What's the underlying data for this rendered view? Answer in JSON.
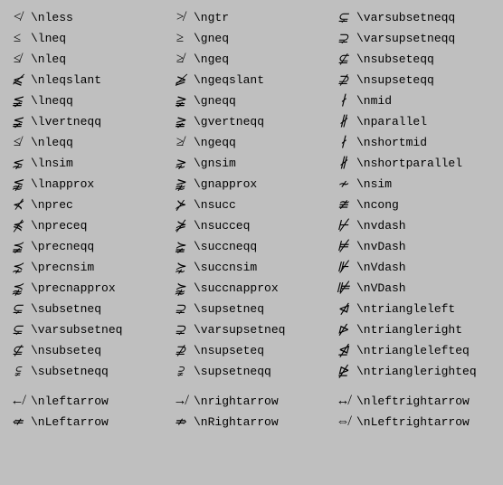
{
  "rows": [
    [
      {
        "sym": "≮",
        "cmd": "\\nless"
      },
      {
        "sym": "≯",
        "cmd": "\\ngtr"
      },
      {
        "sym": "⊊",
        "cmd": "\\varsubsetneqq"
      }
    ],
    [
      {
        "sym": "≤",
        "cmd": "\\lneq"
      },
      {
        "sym": "≥",
        "cmd": "\\gneq"
      },
      {
        "sym": "⊋",
        "cmd": "\\varsupsetneqq"
      }
    ],
    [
      {
        "sym": "≰",
        "cmd": "\\nleq"
      },
      {
        "sym": "≱",
        "cmd": "\\ngeq"
      },
      {
        "sym": "⊈",
        "cmd": "\\nsubseteqq"
      }
    ],
    [
      {
        "sym": "⩽̸",
        "cmd": "\\nleqslant"
      },
      {
        "sym": "⩾̸",
        "cmd": "\\ngeqslant"
      },
      {
        "sym": "⊉",
        "cmd": "\\nsupseteqq"
      }
    ],
    [
      {
        "sym": "≨",
        "cmd": "\\lneqq"
      },
      {
        "sym": "≩",
        "cmd": "\\gneqq"
      },
      {
        "sym": "∤",
        "cmd": "\\nmid"
      }
    ],
    [
      {
        "sym": "≨",
        "cmd": "\\lvertneqq"
      },
      {
        "sym": "≩",
        "cmd": "\\gvertneqq"
      },
      {
        "sym": "∦",
        "cmd": "\\nparallel"
      }
    ],
    [
      {
        "sym": "≰",
        "cmd": "\\nleqq"
      },
      {
        "sym": "≱",
        "cmd": "\\ngeqq"
      },
      {
        "sym": "∤",
        "cmd": "\\nshortmid"
      }
    ],
    [
      {
        "sym": "⋦",
        "cmd": "\\lnsim"
      },
      {
        "sym": "⋧",
        "cmd": "\\gnsim"
      },
      {
        "sym": "∦",
        "cmd": "\\nshortparallel"
      }
    ],
    [
      {
        "sym": "⪉",
        "cmd": "\\lnapprox"
      },
      {
        "sym": "⪊",
        "cmd": "\\gnapprox"
      },
      {
        "sym": "≁",
        "cmd": "\\nsim"
      }
    ],
    [
      {
        "sym": "⊀",
        "cmd": "\\nprec"
      },
      {
        "sym": "⊁",
        "cmd": "\\nsucc"
      },
      {
        "sym": "≇",
        "cmd": "\\ncong"
      }
    ],
    [
      {
        "sym": "⋠",
        "cmd": "\\npreceq"
      },
      {
        "sym": "⋡",
        "cmd": "\\nsucceq"
      },
      {
        "sym": "⊬",
        "cmd": "\\nvdash"
      }
    ],
    [
      {
        "sym": "⪵",
        "cmd": "\\precneqq"
      },
      {
        "sym": "⪶",
        "cmd": "\\succneqq"
      },
      {
        "sym": "⊭",
        "cmd": "\\nvDash"
      }
    ],
    [
      {
        "sym": "⋨",
        "cmd": "\\precnsim"
      },
      {
        "sym": "⋩",
        "cmd": "\\succnsim"
      },
      {
        "sym": "⊮",
        "cmd": "\\nVdash"
      }
    ],
    [
      {
        "sym": "⪹",
        "cmd": "\\precnapprox"
      },
      {
        "sym": "⪺",
        "cmd": "\\succnapprox"
      },
      {
        "sym": "⊯",
        "cmd": "\\nVDash"
      }
    ],
    [
      {
        "sym": "⊊",
        "cmd": "\\subsetneq"
      },
      {
        "sym": "⊋",
        "cmd": "\\supsetneq"
      },
      {
        "sym": "⋪",
        "cmd": "\\ntriangleleft"
      }
    ],
    [
      {
        "sym": "⊊",
        "cmd": "\\varsubsetneq"
      },
      {
        "sym": "⊋",
        "cmd": "\\varsupsetneq"
      },
      {
        "sym": "⋫",
        "cmd": "\\ntriangleright"
      }
    ],
    [
      {
        "sym": "⊈",
        "cmd": "\\nsubseteq"
      },
      {
        "sym": "⊉",
        "cmd": "\\nsupseteq"
      },
      {
        "sym": "⋬",
        "cmd": "\\ntrianglelefteq"
      }
    ],
    [
      {
        "sym": "⫋",
        "cmd": "\\subsetneqq"
      },
      {
        "sym": "⫌",
        "cmd": "\\supsetneqq"
      },
      {
        "sym": "⋭",
        "cmd": "\\ntrianglerighteq"
      }
    ],
    [
      {
        "sym": "↚",
        "cmd": "\\nleftarrow"
      },
      {
        "sym": "↛",
        "cmd": "\\nrightarrow"
      },
      {
        "sym": "↮",
        "cmd": "\\nleftrightarrow"
      }
    ],
    [
      {
        "sym": "⇍",
        "cmd": "\\nLeftarrow"
      },
      {
        "sym": "⇏",
        "cmd": "\\nRightarrow"
      },
      {
        "sym": "⇎",
        "cmd": "\\nLeftrightarrow"
      }
    ]
  ]
}
